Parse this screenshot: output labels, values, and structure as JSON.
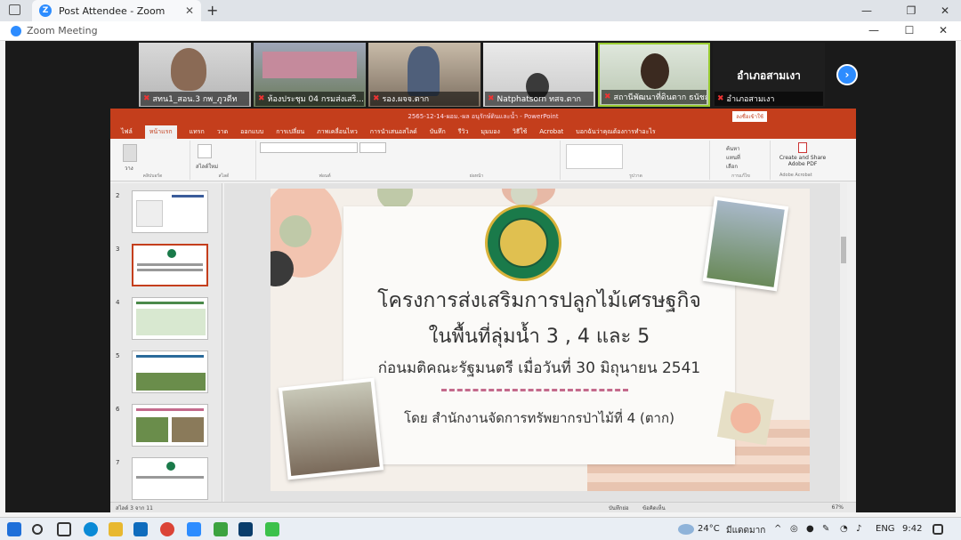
{
  "browser": {
    "tab_title": "Post Attendee - Zoom",
    "tab_close": "✕",
    "new_tab": "+"
  },
  "window_controls": {
    "minimize": "—",
    "maximize": "❐",
    "close": "✕"
  },
  "zoom": {
    "title": "Zoom Meeting",
    "controls": {
      "minimize": "—",
      "maximize": "☐",
      "close": "✕"
    },
    "participants": [
      {
        "name": "สทน1_สอน.3 กพ_ภูวดีท"
      },
      {
        "name": "ห้องประชุม 04 กรมส่งเสริ..."
      },
      {
        "name": "รอง.ผจจ.ตาก"
      },
      {
        "name": "Natphatsorn ทสจ.ตาก"
      },
      {
        "name": "สถานีพัฒนาที่ดินตาก ธนัชญา"
      },
      {
        "name": "อำเภอสามเงา",
        "display_text": "อำเภอสามเงา"
      }
    ],
    "next_icon": "›"
  },
  "ppt": {
    "title": "2565-12-14-ผอม.-ผล อนุรักษ์ดินและน้ำ - PowerPoint",
    "signin": "ลงชื่อเข้าใช้",
    "tabs": [
      "ไฟล์",
      "หน้าแรก",
      "แทรก",
      "วาด",
      "ออกแบบ",
      "การเปลี่ยน",
      "ภาพเคลื่อนไหว",
      "การนำเสนอสไลด์",
      "บันทึก",
      "รีวิว",
      "มุมมอง",
      "วิธีใช้",
      "Acrobat",
      "บอกฉันว่าคุณต้องการทำอะไร"
    ],
    "ribbon": {
      "paste": "วาง",
      "clipboard": "คลิปบอร์ด",
      "new_slide": "สไลด์ใหม่",
      "slides_group": "สไลด์",
      "font_group": "ฟอนต์",
      "paragraph_group": "ย่อหน้า",
      "drawing_group": "รูปวาด",
      "editing_group": "การแก้ไข",
      "find": "ค้นหา",
      "replace": "แทนที่",
      "select": "เลือก",
      "adobe_label": "Create and Share Adobe PDF",
      "adobe_group": "Adobe Acrobat"
    },
    "thumb_numbers": [
      "2",
      "3",
      "4",
      "5",
      "6",
      "7"
    ],
    "slide": {
      "line1": "โครงการส่งเสริมการปลูกไม้เศรษฐกิจ",
      "line2": "ในพื้นที่ลุ่มน้ำ 3 , 4 และ 5",
      "line3": "ก่อนมติคณะรัฐมนตรี เมื่อวันที่ 30 มิถุนายน 2541",
      "line4": "โดย สำนักงานจัดการทรัพยากรป่าไม้ที่ 4 (ตาก)"
    },
    "status": {
      "slide_count": "สไลด์ 3 จาก 11",
      "notes": "บันทึกย่อ",
      "comments": "ข้อคิดเห็น",
      "zoom": "67%"
    }
  },
  "taskbar": {
    "temperature": "24°C",
    "weather": "มีแดดมาก",
    "language": "ENG",
    "time": "9:42"
  },
  "colors": {
    "ppt_red": "#c43e1c",
    "zoom_blue": "#2d8cff",
    "mute_red": "#e33333"
  }
}
